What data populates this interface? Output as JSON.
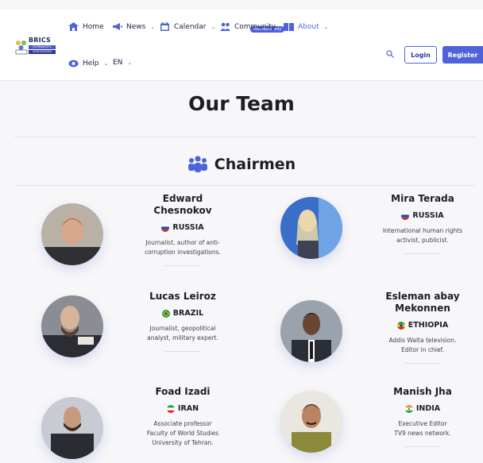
{
  "logo": {
    "brand": "BRICS",
    "line1": "JOURNALISTS",
    "line2": "ASSOCIATION"
  },
  "nav": {
    "home": "Home",
    "news": "News",
    "calendar": "Calendar",
    "community": "Community",
    "community_badge": "Members only",
    "about": "About",
    "help": "Help",
    "language": "EN"
  },
  "auth": {
    "login": "Login",
    "register": "Register"
  },
  "page": {
    "title": "Our Team",
    "section_title": "Chairmen"
  },
  "members": [
    {
      "name": "Edward\nChesnokov",
      "country": "RUSSIA",
      "description": "Journalist, author of anti-\ncorruption investigations."
    },
    {
      "name": "Mira Terada",
      "country": "RUSSIA",
      "description": "International human rights\nactivist, publicist."
    },
    {
      "name": "Lucas Leiroz",
      "country": "BRAZIL",
      "description": "Journalist, geopolitical\nanalyst, military expert."
    },
    {
      "name": "Esleman abay\nMekonnen",
      "country": "ETHIOPIA",
      "description": "Addis Walta television.\nEditor in chief."
    },
    {
      "name": "Foad Izadi",
      "country": "IRAN",
      "description": "Associate professor\nFaculty of World Studies\nUniversity of Tehran."
    },
    {
      "name": "Manish Jha",
      "country": "INDIA",
      "description": "Executive Editor\nTV9 news network."
    }
  ],
  "colors": {
    "accent": "#4f63d9",
    "active_nav": "#5467d9"
  }
}
